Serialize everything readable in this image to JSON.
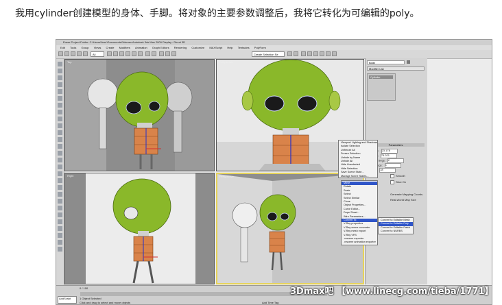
{
  "caption": "我用cylinder创建模型的身体、手脚。将对象的主要参数调整后，我将它转化为可编辑的poly。",
  "app": {
    "title": "Erase    Project Folder: C:\\Users\\Acer\\Documents\\3dsmax    Autodesk 3ds Max 2009    Display : Direct 3D",
    "menus": [
      "Edit",
      "Tools",
      "Group",
      "Views",
      "Create",
      "Modifiers",
      "Animation",
      "Graph Editors",
      "Rendering",
      "Customize",
      "MAXScript",
      "Help",
      "Tentacles",
      "PolyForm"
    ],
    "toolbar": {
      "selection_filter": "All",
      "named_selection": "Create Selection Se"
    }
  },
  "viewports": [
    {
      "label": "Top"
    },
    {
      "label": "Perspective"
    },
    {
      "label": "Right"
    },
    {
      "label": "Perspective"
    }
  ],
  "command_panel": {
    "object_name": "Body",
    "modifier_list": "Modifier List",
    "stack_item": "Cylinder",
    "parameters_title": "Parameters",
    "params": [
      {
        "label": "Radius:",
        "value": "23.178"
      },
      {
        "label": "Height:",
        "value": "75.021"
      },
      {
        "label": "Height Segs:",
        "value": "2"
      },
      {
        "label": "Cap Segs:",
        "value": "1"
      },
      {
        "label": "Sides:",
        "value": "18"
      }
    ],
    "smooth_label": "Smooth",
    "slice_on_label": "Slice On",
    "mapping_label": "Generate Mapping Coords.",
    "real_world_label": "Real-World Map Size"
  },
  "quad_menu_upper": [
    "Viewport Lighting and Shadows",
    "Isolate Selection",
    "Unfreeze All",
    "Freeze Selection",
    "Unhide by Name",
    "Unhide All",
    "Hide Unselected",
    "Hide Selection",
    "Save Scene State...",
    "Manage Scene States..."
  ],
  "quad_menu_lower": [
    "Move",
    "Rotate",
    "Scale",
    "Select",
    "Select Similar",
    "Clone",
    "Object Properties...",
    "Curve Editor...",
    "Dope Sheet...",
    "Wire Parameters...",
    "Convert To:",
    "V-Ray properties",
    "V-Ray scene converter",
    "V-Ray mesh export",
    "V-Ray VFB",
    ".vrscene exporter",
    ".vrscene animation exporter"
  ],
  "convert_submenu": [
    "Convert to Editable Mesh",
    "Convert to Editable Poly",
    "Convert to Editable Patch",
    "Convert to NURBS"
  ],
  "status": {
    "frame": "0 / 100",
    "selection": "1 Object Selected",
    "prompt": "Click and drag to select and move objects",
    "add_time_tag": "Add Time Tag",
    "script_box": "AddScript"
  },
  "watermark": "3Dmax吧 【www.linecg.com/tieba/1771】",
  "colors": {
    "head": "#8ab82a",
    "body": "#d9834a",
    "menu_highlight": "#2f55c8",
    "active_viewport": "#e6d35a"
  }
}
